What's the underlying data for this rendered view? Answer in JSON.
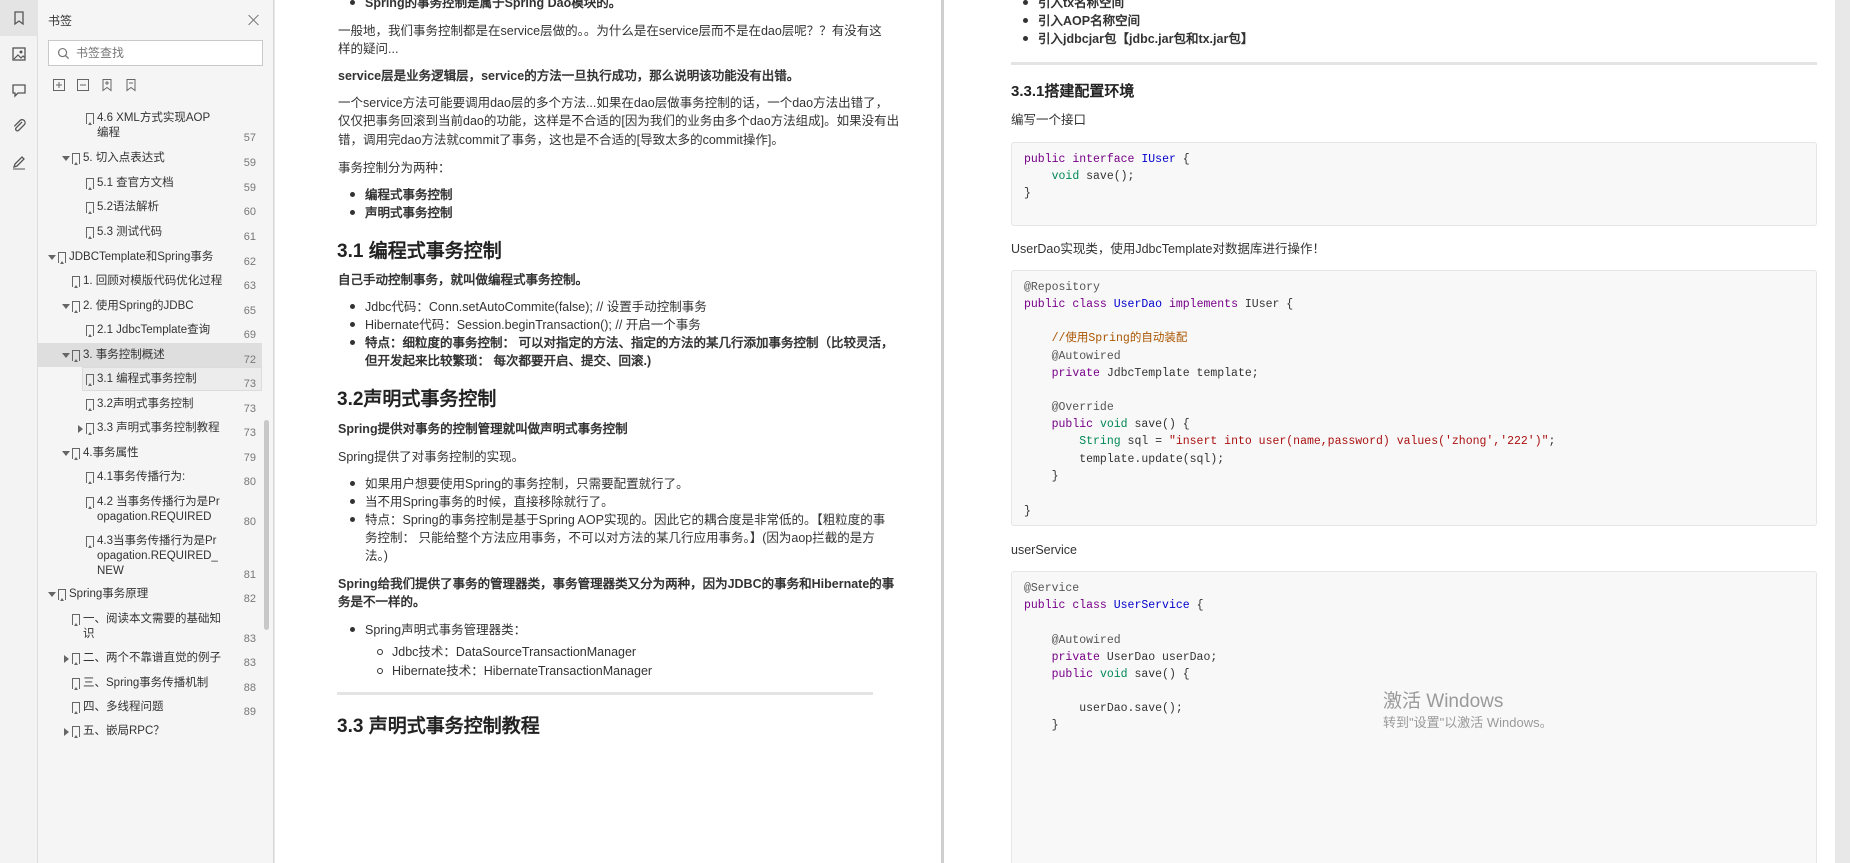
{
  "panel": {
    "title": "书签",
    "search_placeholder": "书签查找"
  },
  "tree": [
    {
      "label": "4.6 XML方式实现AOP",
      "label2": "编程",
      "page": "57"
    },
    {
      "label": "5. 切入点表达式",
      "page": "59"
    },
    {
      "label": "5.1 查官方文档",
      "page": "59"
    },
    {
      "label": "5.2语法解析",
      "page": "60"
    },
    {
      "label": "5.3 测试代码",
      "page": "61"
    },
    {
      "label": "JDBCTemplate和Spring事务",
      "page": "62"
    },
    {
      "label": "1. 回顾对模版代码优化过程",
      "page": "63"
    },
    {
      "label": "2. 使用Spring的JDBC",
      "page": "65"
    },
    {
      "label": "2.1 JdbcTemplate查询",
      "page": "69"
    },
    {
      "label": "3. 事务控制概述",
      "page": "72"
    },
    {
      "label": "3.1 编程式事务控制",
      "page": "73"
    },
    {
      "label": "3.2声明式事务控制",
      "page": "73"
    },
    {
      "label": "3.3 声明式事务控制教程",
      "page": "73"
    },
    {
      "label": "4.事务属性",
      "page": "79"
    },
    {
      "label": "4.1事务传播行为:",
      "page": "80"
    },
    {
      "label": "4.2 当事务传播行为是Pr",
      "label2": "opagation.REQUIRED",
      "page": "80"
    },
    {
      "label": "4.3当事务传播行为是Pr",
      "label2": "opagation.REQUIRED_",
      "label3": "NEW",
      "page": "81"
    },
    {
      "label": "Spring事务原理",
      "page": "82"
    },
    {
      "label": "一、阅读本文需要的基础知",
      "label2": "识",
      "page": "83"
    },
    {
      "label": "二、两个不靠谱直觉的例子",
      "page": "83"
    },
    {
      "label": "三、Spring事务传播机制",
      "page": "88"
    },
    {
      "label": "四、多线程问题",
      "page": "89"
    },
    {
      "label": "五、嵌局RPC？",
      "page": ""
    }
  ],
  "left_page": {
    "t1": "Spring的事务控制是属于Spring Dao模块的。",
    "p1a": "一般地，我们事务控制都是在service层做的。。为什么是在service层而不是在dao层呢？？有没有这",
    "p1b": "样的疑问...",
    "p2": "service层是业务逻辑层，service的方法一旦执行成功，那么说明该功能没有出错。",
    "p3a": "一个service方法可能要调用dao层的多个方法...如果在dao层做事务控制的话，一个dao方法出错了，",
    "p3b": "仅仅把事务回滚到当前dao的功能，这样是不合适的[因为我们的业务由多个dao方法组成]。如果没有出",
    "p3c": "错，调用完dao方法就commit了事务，这也是不合适的[导致太多的commit操作]。",
    "p4": "事务控制分为两种：",
    "b1": "编程式事务控制",
    "b2": "声明式事务控制",
    "h31": "3.1 编程式事务控制",
    "p5": "自己手动控制事务，就叫做编程式事务控制。",
    "b3": "Jdbc代码：Conn.setAutoCommite(false); // 设置手动控制事务",
    "b4": "Hibernate代码：Session.beginTransaction();    // 开启一个事务",
    "b5a": "特点：细粒度的事务控制：  可以对指定的方法、指定的方法的某几行添加事务控制（比较灵活，",
    "b5b": "但开发起来比较繁琐：  每次都要开启、提交、回滚.)",
    "h32": "3.2声明式事务控制",
    "p6": "Spring提供对事务的控制管理就叫做声明式事务控制",
    "p7": "Spring提供了对事务控制的实现。",
    "b6": "如果用户想要使用Spring的事务控制，只需要配置就行了。",
    "b7": "当不用Spring事务的时候，直接移除就行了。",
    "b8a": "特点：Spring的事务控制是基于Spring AOP实现的。因此它的耦合度是非常低的。【粗粒度的事",
    "b8b": "务控制：  只能给整个方法应用事务，不可以对方法的某几行应用事务。】(因为aop拦截的是方",
    "b8c": "法。)",
    "p8a": "Spring给我们提供了事务的管理器类，事务管理器类又分为两种，因为JDBC的事务和Hibernate的事",
    "p8b": "务是不一样的。",
    "b9": "Spring声明式事务管理器类：",
    "b10": "Jdbc技术：DataSourceTransactionManager",
    "b11": "Hibernate技术：HibernateTransactionManager",
    "h33": "3.3 声明式事务控制教程"
  },
  "right_page": {
    "r1": "引入tx名称空间",
    "r2": "引入AOP名称空间",
    "r3": "引入jdbcjar包【jdbc.jar包和tx.jar包】",
    "h": "3.3.1搭建配置环境",
    "p1": "编写一个接口",
    "p2": "UserDao实现类，使用JdbcTemplate对数据库进行操作！",
    "p3": "userService"
  },
  "watermark": {
    "line1": "激活 Windows",
    "line2": "转到\"设置\"以激活 Windows。"
  },
  "colors": {
    "keyword": "#770088",
    "type": "#0000cc",
    "comment": "#aa5500",
    "string": "#aa1111"
  }
}
